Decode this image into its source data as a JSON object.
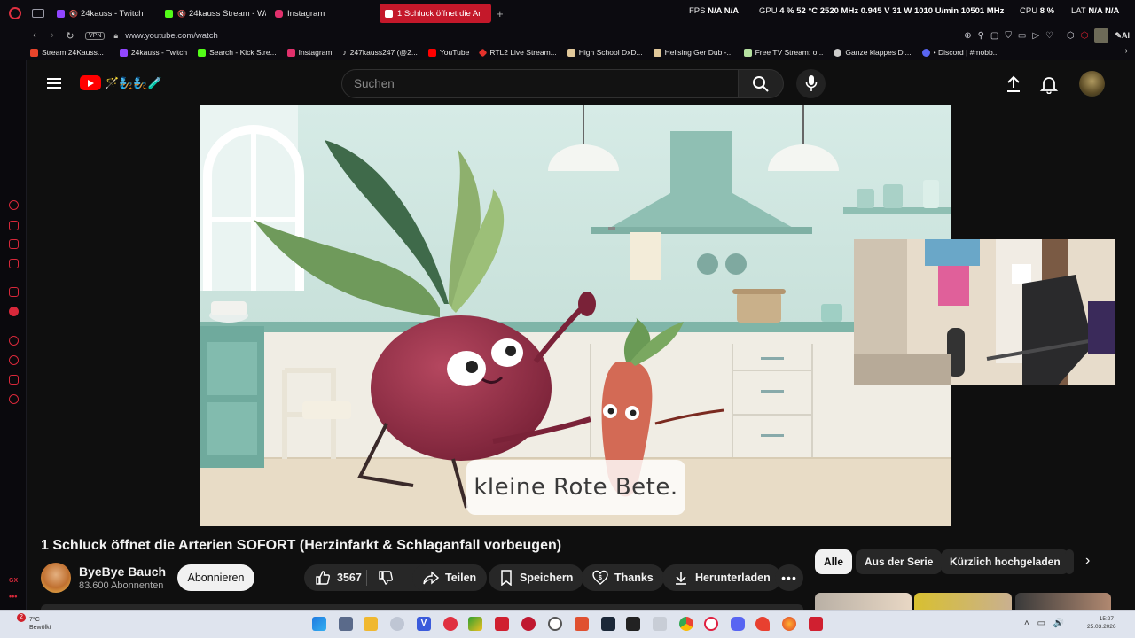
{
  "browser": {
    "tabs": [
      {
        "label": "24kauss - Twitch",
        "color": "#9146ff"
      },
      {
        "label": "24kauss Stream - Wa",
        "color": "#53fc18"
      },
      {
        "label": "Instagram",
        "color": "#e1306c"
      },
      {
        "label": "1 Schluck öffnet die Ar",
        "color": "#ff0000",
        "active": true
      }
    ],
    "url": "www.youtube.com/watch",
    "vpn_label": "VPN",
    "ai_label": "AI",
    "bookmarks": [
      {
        "label": "Stream 24Kauss...",
        "color": "#e8442b"
      },
      {
        "label": "24kauss - Twitch",
        "color": "#9146ff"
      },
      {
        "label": "Search - Kick Stre...",
        "color": "#53fc18"
      },
      {
        "label": "Instagram",
        "color": "#e1306c"
      },
      {
        "label": "247kauss247 (@2...",
        "color": "#111111"
      },
      {
        "label": "YouTube",
        "color": "#ff0000"
      },
      {
        "label": "RTL2 Live Stream...",
        "color": "#e4312b"
      },
      {
        "label": "High School DxD...",
        "color": "#e0c79a"
      },
      {
        "label": "Hellsing Ger Dub -...",
        "color": "#e0c79a"
      },
      {
        "label": "Free TV Stream: o...",
        "color": "#b5e0a0"
      },
      {
        "label": "Ganze klappes Di...",
        "color": "#cccccc"
      },
      {
        "label": "• Discord | #mobb...",
        "color": "#5865f2"
      }
    ]
  },
  "hud": {
    "fps_label": "FPS",
    "fps_value": "N/A",
    "fps_value2": "N/A",
    "gpu_label": "GPU",
    "gpu_load": "4 %",
    "gpu_temp": "52 °C",
    "gpu_clock": "2520 MHz",
    "gpu_volt": "0.945 V",
    "gpu_power": "31 W",
    "gpu_fan": "1010 U/min",
    "gpu_mem": "10501 MHz",
    "cpu_label": "CPU",
    "cpu_load": "8 %",
    "lat_label": "LAT",
    "lat_value": "N/A",
    "lat_value2": "N/A"
  },
  "youtube": {
    "logo_deco": "🪄🧞🧞🧪",
    "search": {
      "placeholder": "Suchen"
    },
    "video": {
      "caption": "kleine Rote Bete."
    },
    "title": "1 Schluck öffnet die Arterien SOFORT (Herzinfarkt & Schlaganfall vorbeugen)",
    "channel": {
      "name": "ByeBye Bauch",
      "subscribers": "83.600 Abonnenten"
    },
    "subscribe_label": "Abonnieren",
    "actions": {
      "likes": "3567",
      "share": "Teilen",
      "save": "Speichern",
      "thanks": "Thanks",
      "download": "Herunterladen",
      "more": "•••"
    },
    "chips": [
      "Alle",
      "Aus der Serie",
      "Kürzlich hochgeladen"
    ],
    "sidebar_badge": "GX"
  },
  "taskbar": {
    "weather_temp": "7°C",
    "weather_desc": "Bewölkt",
    "notif_count": "2",
    "time": "15:27",
    "date": "25.03.2026",
    "tray": "˄ ▭ 🔊"
  }
}
